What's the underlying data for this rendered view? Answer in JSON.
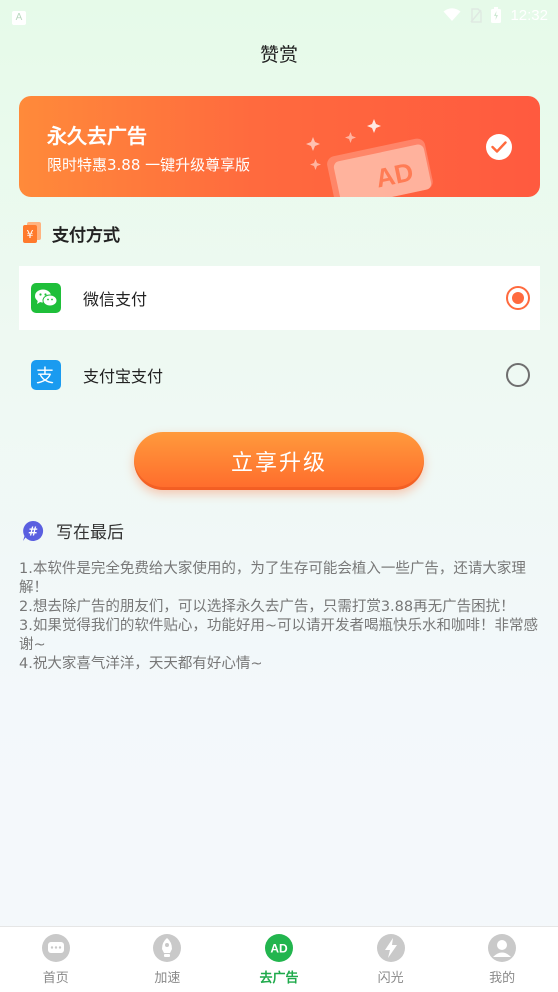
{
  "status_bar": {
    "time": "12:32",
    "left_icon_letter": "A"
  },
  "page": {
    "title": "赞赏"
  },
  "ad_card": {
    "title": "永久去广告",
    "subtitle": "限时特惠3.88   一键升级尊享版",
    "art_text": "AD",
    "selected": true
  },
  "payment": {
    "section_label": "支付方式",
    "section_icon": "yuan-icon",
    "options": [
      {
        "label": "微信支付",
        "icon": "wechat-pay-icon",
        "selected": true
      },
      {
        "label": "支付宝支付",
        "icon": "alipay-icon",
        "selected": false
      }
    ]
  },
  "upgrade_button": {
    "label": "立享升级"
  },
  "notes": {
    "section_label": "写在最后",
    "section_icon": "hash-icon",
    "lines": [
      "1.本软件是完全免费给大家使用的，为了生存可能会植入一些广告，还请大家理解！",
      "2.想去除广告的朋友们，可以选择永久去广告，只需打赏3.88再无广告困扰！",
      "3.如果觉得我们的软件贴心，功能好用~可以请开发者喝瓶快乐水和咖啡！非常感谢~",
      "4.祝大家喜气洋洋，天天都有好心情~"
    ]
  },
  "tabbar": {
    "items": [
      {
        "label": "首页",
        "icon": "chat-bubble-icon",
        "active": false
      },
      {
        "label": "加速",
        "icon": "rocket-icon",
        "active": false
      },
      {
        "label": "去广告",
        "icon": "ad-icon",
        "icon_text": "AD",
        "active": true
      },
      {
        "label": "闪光",
        "icon": "lightning-icon",
        "active": false
      },
      {
        "label": "我的",
        "icon": "user-icon",
        "active": false
      }
    ]
  },
  "colors": {
    "accent_orange": "#ff6a3e",
    "active_green": "#1faa4b",
    "wechat_green": "#1fbf3a",
    "alipay_blue": "#1a9bf0"
  }
}
